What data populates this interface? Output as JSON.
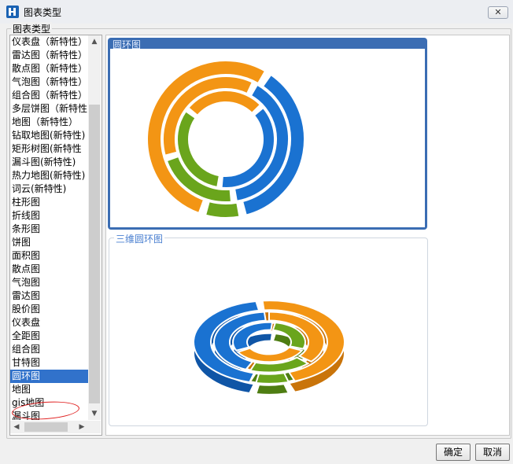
{
  "window": {
    "title": "图表类型",
    "close_label": "✕"
  },
  "group_label": "图表类型",
  "chart_types": [
    "仪表盘（新特性）",
    "雷达图（新特性）",
    "散点图（新特性）",
    "气泡图（新特性）",
    "组合图（新特性）",
    "多层饼图（新特性",
    "地图（新特性）",
    "钻取地图(新特性)",
    "矩形树图(新特性",
    "漏斗图(新特性)",
    "热力地图(新特性)",
    "词云(新特性)",
    "柱形图",
    "折线图",
    "条形图",
    "饼图",
    "面积图",
    "散点图",
    "气泡图",
    "雷达图",
    "股价图",
    "仪表盘",
    "全距图",
    "组合图",
    "甘特图",
    "圆环图",
    "地图",
    "gis地图",
    "漏斗图"
  ],
  "selected_type": "圆环图",
  "previews": {
    "ring": {
      "label": "圆环图"
    },
    "ring3d": {
      "label": "三维圆环图"
    }
  },
  "buttons": {
    "ok": "确定",
    "cancel": "取消"
  },
  "colors": {
    "orange": "#f39514",
    "blue": "#1a72d1",
    "green": "#6aa51c",
    "selection": "#3172cb",
    "annotation": "#e02020"
  }
}
